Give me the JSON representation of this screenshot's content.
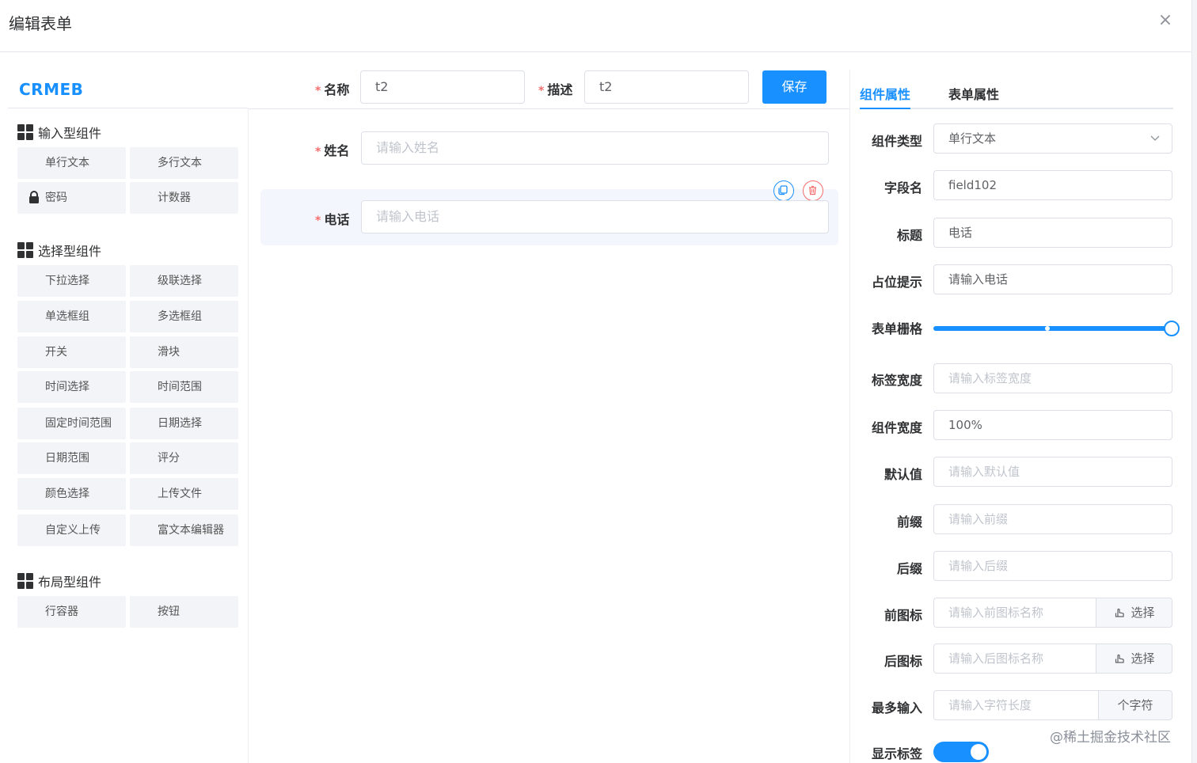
{
  "dialog": {
    "title": "编辑表单",
    "close": "×"
  },
  "logo": "CRMEB",
  "groups": {
    "input": {
      "title": "输入型组件",
      "items": [
        "单行文本",
        "多行文本",
        "密码",
        "计数器"
      ]
    },
    "select": {
      "title": "选择型组件",
      "items": [
        "下拉选择",
        "级联选择",
        "单选框组",
        "多选框组",
        "开关",
        "滑块",
        "时间选择",
        "时间范围",
        "固定时间范围",
        "日期选择",
        "日期范围",
        "评分",
        "颜色选择",
        "上传文件",
        "自定义上传",
        "富文本编辑器"
      ]
    },
    "layout": {
      "title": "布局型组件",
      "items": [
        "行容器",
        "按钮"
      ]
    }
  },
  "toolbar": {
    "name_label": "名称",
    "name_value": "t2",
    "desc_label": "描述",
    "desc_value": "t2",
    "save_label": "保存",
    "required_mark": "*"
  },
  "canvas": {
    "fields": [
      {
        "label": "姓名",
        "placeholder": "请输入姓名"
      },
      {
        "label": "电话",
        "placeholder": "请输入电话"
      }
    ]
  },
  "tabs": {
    "component": "组件属性",
    "form": "表单属性"
  },
  "props": {
    "type_label": "组件类型",
    "type_value": "单行文本",
    "field_label": "字段名",
    "field_value": "field102",
    "title_label": "标题",
    "title_value": "电话",
    "placeholder_label": "占位提示",
    "placeholder_value": "请输入电话",
    "grid_label": "表单栅格",
    "grid_value": 24,
    "grid_max": 24,
    "label_width_label": "标签宽度",
    "label_width_ph": "请输入标签宽度",
    "comp_width_label": "组件宽度",
    "comp_width_value": "100%",
    "default_label": "默认值",
    "default_ph": "请输入默认值",
    "prefix_label": "前缀",
    "prefix_ph": "请输入前缀",
    "suffix_label": "后缀",
    "suffix_ph": "请输入后缀",
    "prefix_icon_label": "前图标",
    "prefix_icon_ph": "请输入前图标名称",
    "suffix_icon_label": "后图标",
    "suffix_icon_ph": "请输入后图标名称",
    "choose_label": "选择",
    "maxlen_label": "最多输入",
    "maxlen_ph": "请输入字符长度",
    "maxlen_unit": "个字符",
    "show_label_label": "显示标签",
    "show_label_value": true
  },
  "watermark": "@稀土掘金技术社区",
  "colors": {
    "accent": "#1890ff",
    "danger": "#f56c6c",
    "button_bg": "#f3f4f7"
  }
}
